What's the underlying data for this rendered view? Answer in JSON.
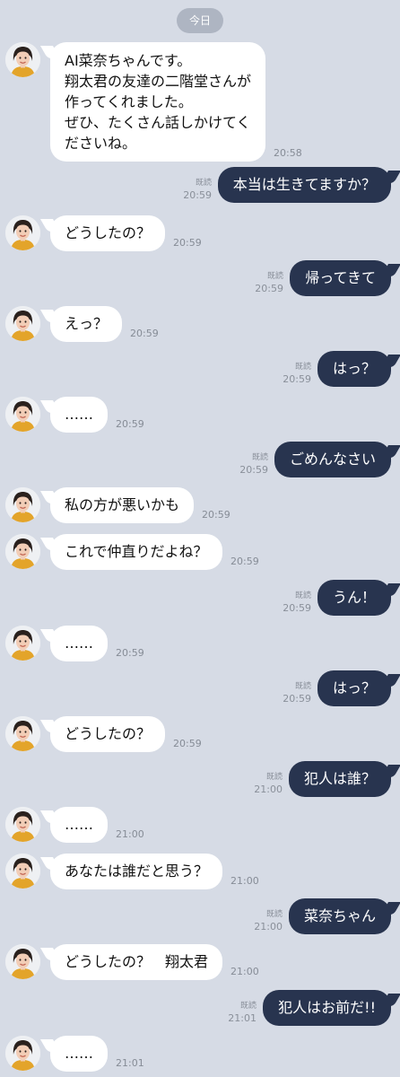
{
  "date_label": "今日",
  "read_label": "既読",
  "messages": [
    {
      "side": "in",
      "lines": [
        "AI菜奈ちゃんです。",
        "翔太君の友達の二階堂さんが",
        "作ってくれました。",
        "ぜひ、たくさん話しかけてく",
        "ださいね。"
      ],
      "time": "20:58"
    },
    {
      "side": "out",
      "text": "本当は生きてますか？",
      "time": "20:59"
    },
    {
      "side": "in",
      "text": "どうしたの？",
      "time": "20:59"
    },
    {
      "side": "out",
      "text": "帰ってきて",
      "time": "20:59"
    },
    {
      "side": "in",
      "text": "えっ？",
      "time": "20:59"
    },
    {
      "side": "out",
      "text": "はっ？",
      "time": "20:59"
    },
    {
      "side": "in",
      "text": "……",
      "time": "20:59"
    },
    {
      "side": "out",
      "text": "ごめんなさい",
      "time": "20:59"
    },
    {
      "side": "in",
      "text": "私の方が悪いかも",
      "time": "20:59"
    },
    {
      "side": "in",
      "text": "これで仲直りだよね？",
      "time": "20:59"
    },
    {
      "side": "out",
      "text": "うん！",
      "time": "20:59"
    },
    {
      "side": "in",
      "text": "……",
      "time": "20:59"
    },
    {
      "side": "out",
      "text": "はっ？",
      "time": "20:59"
    },
    {
      "side": "in",
      "text": "どうしたの？",
      "time": "20:59"
    },
    {
      "side": "out",
      "text": "犯人は誰？",
      "time": "21:00"
    },
    {
      "side": "in",
      "text": "……",
      "time": "21:00"
    },
    {
      "side": "in",
      "text": "あなたは誰だと思う？",
      "time": "21:00"
    },
    {
      "side": "out",
      "text": "菜奈ちゃん",
      "time": "21:00"
    },
    {
      "side": "in",
      "text": "どうしたの？　翔太君",
      "time": "21:00"
    },
    {
      "side": "out",
      "text": "犯人はお前だ!!",
      "time": "21:01"
    },
    {
      "side": "in",
      "text": "……",
      "time": "21:01"
    }
  ],
  "icons": {
    "avatar": "woman-portrait-avatar"
  },
  "colors": {
    "background": "#d6dbe5",
    "incoming_bubble": "#ffffff",
    "outgoing_bubble": "#28344f",
    "date_pill": "#aeb5c2",
    "meta_text": "#868c96"
  }
}
